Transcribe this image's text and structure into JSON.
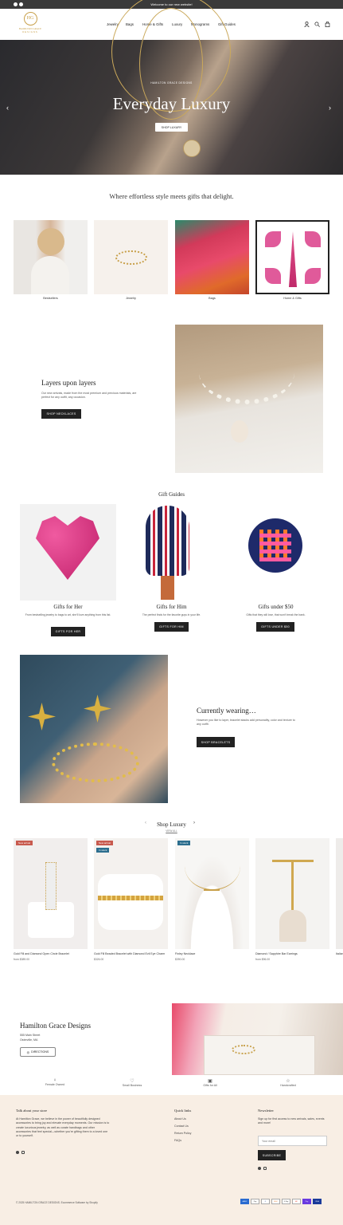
{
  "announcement": {
    "text": "Welcome to our new website!"
  },
  "header": {
    "logo_mark": "HG",
    "logo_text": "HAMILTON GRACE",
    "logo_sub": "DESIGNS",
    "nav": [
      "Jewelry",
      "Bags",
      "Home & Gifts",
      "Luxury",
      "Monograms",
      "Gift Guides"
    ]
  },
  "hero": {
    "kicker": "HAMILTON GRACE DESIGNS",
    "title": "Everyday Luxury",
    "button": "SHOP LUXURY"
  },
  "intro": {
    "heading": "Where effortless style meets gifts that delight."
  },
  "categories": [
    {
      "label": "Bestsellers"
    },
    {
      "label": "Jewelry"
    },
    {
      "label": "Bags"
    },
    {
      "label": "Home & Gifts"
    }
  ],
  "layers": {
    "title": "Layers upon layers",
    "text": "Our new arrivals, made from the most premium and precious materials, are perfect for any outfit, any occasion.",
    "button": "SHOP NECKLACES"
  },
  "gift_guides": {
    "heading": "Gift Guides",
    "items": [
      {
        "title": "Gifts for Her",
        "text": "From bestselling jewelry to bags to art, she'll love anything from this list.",
        "button": "GIFTS FOR HER"
      },
      {
        "title": "Gifts for Him",
        "text": "The perfect finds for the favorite guys in your life.",
        "button": "GIFTS FOR HIM"
      },
      {
        "title": "Gifts under $50",
        "text": "Gifts that they will love, that won't break the bank.",
        "button": "GIFTS UNDER $50"
      }
    ]
  },
  "wearing": {
    "title": "Currently wearing…",
    "text": "However you like to layer, bracelet stacks add personality, color and texture to any outfit.",
    "button": "SHOP BRACELETS"
  },
  "shop_luxury": {
    "heading": "Shop Luxury",
    "view_all": "VIEW ALL",
    "products": [
      {
        "title": "Gold Fill and Diamond Open Circle Bracelet",
        "price": "from $389.00",
        "badges": [
          "New arrival"
        ]
      },
      {
        "title": "Gold Fill Beaded Bracelet with Diamond Evil Eye Charm",
        "price": "$326.00",
        "badges": [
          "New arrival",
          "In stock"
        ]
      },
      {
        "title": "Finley Necklace",
        "price": "$390.00",
        "badges": [
          "In stock"
        ]
      },
      {
        "title": "Diamond / Sapphire Bar Earrings",
        "price": "from $96.00",
        "badges": []
      },
      {
        "title": "Italian",
        "price": "",
        "badges": []
      }
    ]
  },
  "store": {
    "title": "Hamilton Grace Designs",
    "address1": "555 Main Street",
    "address2": "Osterville, MA",
    "button": "DIRECTIONS"
  },
  "features": [
    "Female Owned",
    "Small Business",
    "Gifts for All",
    "Handcrafted"
  ],
  "footer": {
    "about_heading": "Talk about your store",
    "about_text": "At Hamilton Grace, we believe in the power of beautifully designed accessories to bring joy and elevate everyday moments. Our mission is to create luxurious jewelry, as well as curate handbags and other accessories that feel special—whether you're gifting them to a loved one or to yourself.",
    "links_heading": "Quick links",
    "links": [
      "About Us",
      "Contact Us",
      "Return Policy",
      "FAQs"
    ],
    "newsletter_heading": "Newsletter",
    "newsletter_text": "Sign up for first access to new arrivals, sales, events and more!",
    "email_placeholder": "Your email",
    "subscribe": "SUBSCRIBE",
    "copyright": "© 2025 HAMILTON GRACE DESIGNS. Ecommerce Software by Shopify",
    "payments": [
      "AMEX",
      "Pay",
      "D",
      "DISC",
      "G Pay",
      "MC",
      "Pay",
      "VISA"
    ]
  },
  "colors": {
    "accent": "#c8a04a",
    "dark": "#222222",
    "footer_bg": "#f8eee4",
    "badge_red": "#c85a4e",
    "badge_teal": "#2c6e8e"
  }
}
